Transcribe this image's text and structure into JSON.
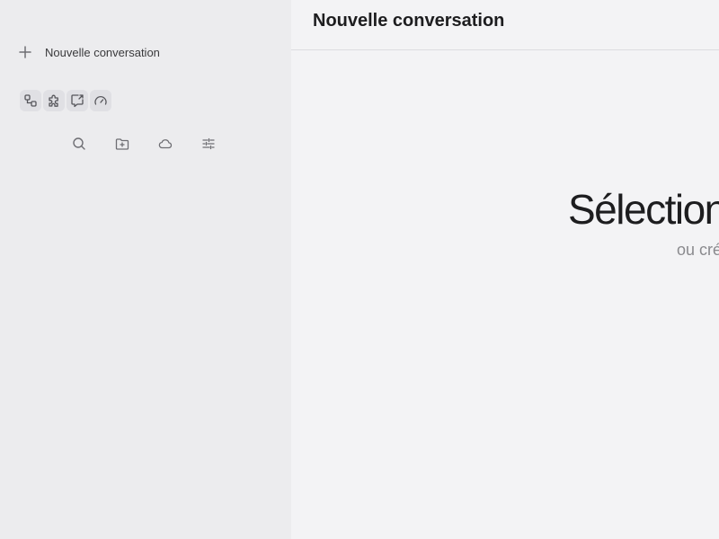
{
  "sidebar": {
    "new_conversation_label": "Nouvelle conversation",
    "plugins": [
      {
        "icon": "flow-icon"
      },
      {
        "icon": "puzzle-icon"
      },
      {
        "icon": "share-chat-icon"
      },
      {
        "icon": "gauge-icon"
      }
    ],
    "tools": [
      {
        "icon": "search-icon"
      },
      {
        "icon": "folder-plus-icon"
      },
      {
        "icon": "cloud-icon"
      },
      {
        "icon": "sliders-icon"
      }
    ]
  },
  "header": {
    "title": "Nouvelle conversation"
  },
  "empty_state": {
    "title": "Sélection",
    "subtitle": "ou cré"
  },
  "colors": {
    "sidebar_bg": "#ececee",
    "main_bg": "#f3f3f5",
    "icon_tile_bg": "#e0e0e4",
    "text_primary": "#1d1d1f",
    "text_muted": "#8a8a8e"
  }
}
